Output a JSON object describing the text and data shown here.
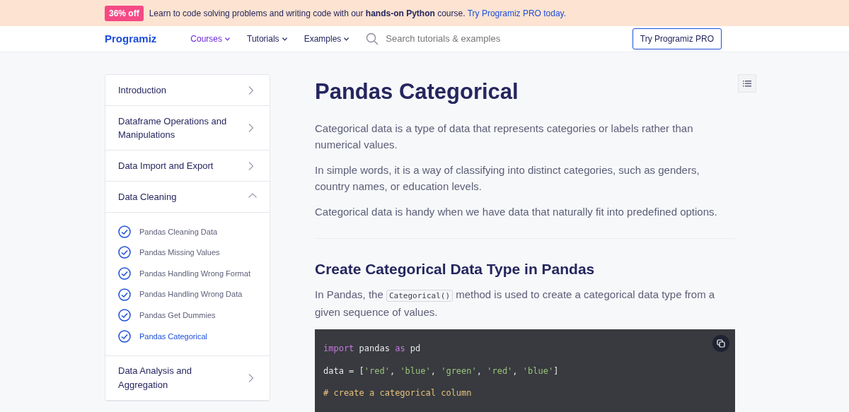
{
  "promo": {
    "badge": "36% off",
    "text": "Learn to code solving problems and writing code with our **hands-on Python** course.",
    "link": "Try Programiz PRO today."
  },
  "navbar": {
    "logo": "Programiz",
    "menus": [
      {
        "label": "Courses",
        "selected": true
      },
      {
        "label": "Tutorials",
        "selected": false
      },
      {
        "label": "Examples",
        "selected": false
      }
    ],
    "search": {
      "placeholder": "Search tutorials & examples"
    },
    "cta": "Try Programiz PRO"
  },
  "sidebar": {
    "items": [
      {
        "label": "Introduction",
        "expanded": false
      },
      {
        "label": "Dataframe Operations and Manipulations",
        "expanded": false
      },
      {
        "label": "Data Import and Export",
        "expanded": false
      },
      {
        "label": "Data Cleaning",
        "expanded": true,
        "children": [
          {
            "label": "Pandas Cleaning Data",
            "selected": false
          },
          {
            "label": "Pandas Missing Values",
            "selected": false
          },
          {
            "label": "Pandas Handling Wrong Format",
            "selected": false
          },
          {
            "label": "Pandas Handling Wrong Data",
            "selected": false
          },
          {
            "label": "Pandas Get Dummies",
            "selected": false
          },
          {
            "label": "Pandas Categorical",
            "selected": true
          }
        ]
      },
      {
        "label": "Data Analysis and Aggregation",
        "expanded": false
      }
    ]
  },
  "article": {
    "title": "Pandas Categorical",
    "paragraphs": [
      "Categorical data is a type of data that represents categories or labels rather than numerical values.",
      "In simple words, it is a way of classifying into distinct categories, such as genders, country names, or education levels.",
      "Categorical data is handy when we have data that naturally fit into predefined options."
    ],
    "section_title": "Create Categorical Data Type in Pandas",
    "section_text": [
      {
        "kind": "text",
        "text": "In Pandas, the "
      },
      {
        "kind": "code",
        "text": "Categorical()"
      },
      {
        "kind": "text",
        "text": " method is used to create a categorical data type from a given sequence of values."
      }
    ],
    "code_tokens": [
      {
        "kind": "keyword",
        "text": "import"
      },
      {
        "kind": "plain",
        "text": " pandas "
      },
      {
        "kind": "keyword",
        "text": "as"
      },
      {
        "kind": "plain",
        "text": " pd\n\ndata = ["
      },
      {
        "kind": "string",
        "text": "'red'"
      },
      {
        "kind": "plain",
        "text": ", "
      },
      {
        "kind": "string",
        "text": "'blue'"
      },
      {
        "kind": "plain",
        "text": ", "
      },
      {
        "kind": "string",
        "text": "'green'"
      },
      {
        "kind": "plain",
        "text": ", "
      },
      {
        "kind": "string",
        "text": "'red'"
      },
      {
        "kind": "plain",
        "text": ", "
      },
      {
        "kind": "string",
        "text": "'blue'"
      },
      {
        "kind": "plain",
        "text": "]\n\n"
      },
      {
        "kind": "comment",
        "text": "# create a categorical column"
      }
    ]
  }
}
